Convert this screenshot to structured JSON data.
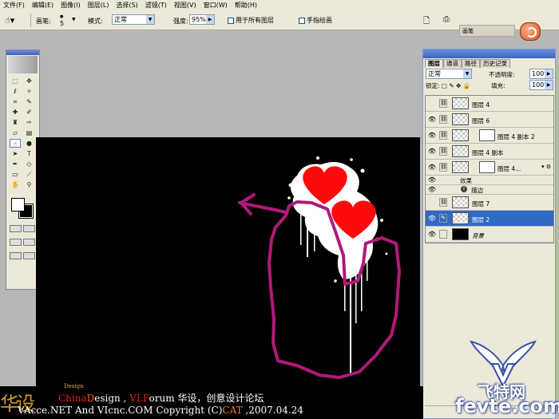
{
  "menubar": {
    "items": [
      "文件(F)",
      "编辑(E)",
      "图像(I)",
      "图层(L)",
      "选择(S)",
      "滤镜(T)",
      "视图(V)",
      "窗口(W)",
      "帮助(H)"
    ]
  },
  "options": {
    "brush_label": "画笔:",
    "brush_size": "5",
    "mode_label": "模式:",
    "mode_value": "正常",
    "strength_label": "强度:",
    "strength_value": "95%",
    "sample_all_label": "用于所有图层",
    "finger_label": "手指绘画",
    "palette_well": "画笔"
  },
  "layers_panel": {
    "tabs": [
      "图层",
      "通道",
      "路径",
      "历史记录"
    ],
    "blend_mode": "正常",
    "opacity_label": "不透明度:",
    "opacity_value": "100%",
    "lock_label": "锁定:",
    "fill_label": "填充:",
    "fill_value": "100%",
    "layers": [
      {
        "name": "图层 4",
        "visible": false,
        "kind": "layer"
      },
      {
        "name": "图层 6",
        "visible": true,
        "kind": "layer"
      },
      {
        "name": "图层 4 副本 2",
        "visible": true,
        "kind": "masked"
      },
      {
        "name": "图层 4 副本",
        "visible": true,
        "kind": "layer"
      },
      {
        "name": "图层 4...",
        "visible": true,
        "kind": "masked-fx"
      },
      {
        "name": "效果",
        "visible": true,
        "kind": "effects"
      },
      {
        "name": "描边",
        "visible": true,
        "kind": "effect-item"
      },
      {
        "name": "图层 7",
        "visible": false,
        "kind": "layer"
      },
      {
        "name": "图层 2",
        "visible": true,
        "kind": "active"
      },
      {
        "name": "背景",
        "visible": true,
        "kind": "background"
      }
    ]
  },
  "credits": {
    "line1_a": "China",
    "line1_b": "D",
    "line1_c": "esign , ",
    "line1_d": "VLF",
    "line1_e": "orum  华设，创意设计论坛",
    "line2_a": "VAcce.NET  And  VIcnc.COM  Copyright (C)",
    "line2_b": "CAT",
    "line2_c": " ,2007.04.24",
    "tag": "Design",
    "callig": "华设"
  },
  "watermark": {
    "line1": "飞特网",
    "line2": "fevte.com"
  },
  "colors": {
    "accent_pink": "#b1197a",
    "heart_red": "#ff0a0a"
  }
}
